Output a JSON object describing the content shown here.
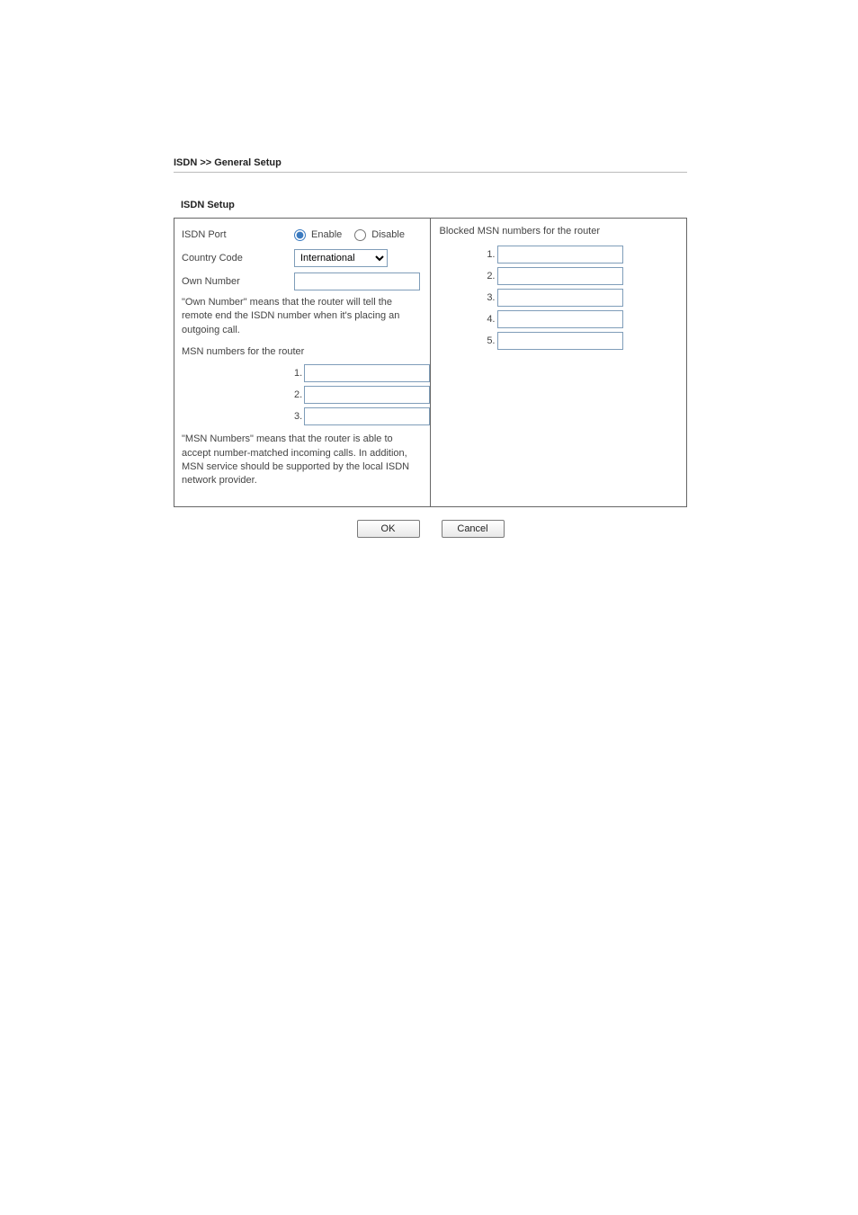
{
  "breadcrumb": "ISDN >> General Setup",
  "section_title": "ISDN Setup",
  "left": {
    "isdn_port_label": "ISDN Port",
    "enable_label": "Enable",
    "disable_label": "Disable",
    "country_code_label": "Country Code",
    "country_code_value": "International",
    "own_number_label": "Own Number",
    "own_number_value": "",
    "own_number_msg": "\"Own Number\" means that the router will tell the remote end the ISDN number when it's placing an outgoing call.",
    "msn_label": "MSN numbers for the router",
    "msn_numbers": {
      "n1": {
        "idx": "1.",
        "val": ""
      },
      "n2": {
        "idx": "2.",
        "val": ""
      },
      "n3": {
        "idx": "3.",
        "val": ""
      }
    },
    "msn_msg": "\"MSN Numbers\" means that the router is able to accept number-matched incoming calls. In addition, MSN service should be supported by the local ISDN network provider."
  },
  "right": {
    "blocked_label": "Blocked MSN numbers for the router",
    "blocked": {
      "b1": {
        "idx": "1.",
        "val": ""
      },
      "b2": {
        "idx": "2.",
        "val": ""
      },
      "b3": {
        "idx": "3.",
        "val": ""
      },
      "b4": {
        "idx": "4.",
        "val": ""
      },
      "b5": {
        "idx": "5.",
        "val": ""
      }
    }
  },
  "buttons": {
    "ok": "OK",
    "cancel": "Cancel"
  }
}
